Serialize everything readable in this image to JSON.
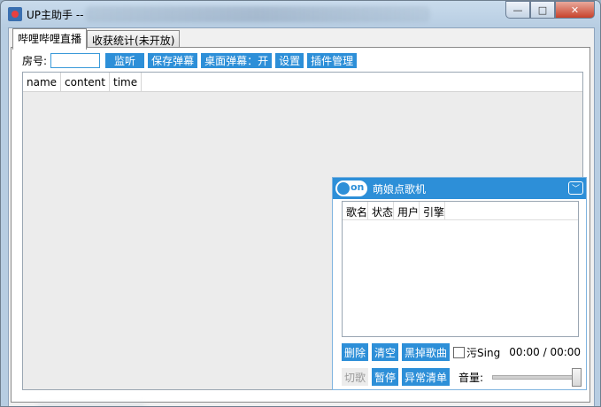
{
  "window": {
    "title": "UP主助手 --",
    "buttons": {
      "minimize": "—",
      "maximize": "□",
      "close": "✕"
    }
  },
  "tabs": [
    {
      "label": "哔哩哔哩直播",
      "active": true
    },
    {
      "label": "收获统计(未开放)",
      "active": false
    }
  ],
  "toolbar": {
    "room_label": "房号:",
    "room_value": "",
    "buttons": [
      "监听",
      "保存弹幕",
      "桌面弹幕：开",
      "设置",
      "插件管理"
    ]
  },
  "danmaku_table": {
    "columns": [
      "name",
      "content",
      "time"
    ],
    "rows": []
  },
  "song_panel": {
    "toggle_label": "on",
    "title": "萌娘点歌机",
    "columns": [
      "歌名",
      "状态",
      "用户",
      "引擎"
    ],
    "rows": [],
    "buttons_row1": [
      "删除",
      "清空",
      "黑掉歌曲"
    ],
    "checkbox_label": "污Sing",
    "time_display": "00:00 / 00:00",
    "buttons_row2": [
      "切歌",
      "暂停",
      "异常清单"
    ],
    "volume_label": "音量:",
    "volume_level": 1.0,
    "colors": {
      "accent": "#2d8fd8"
    }
  }
}
